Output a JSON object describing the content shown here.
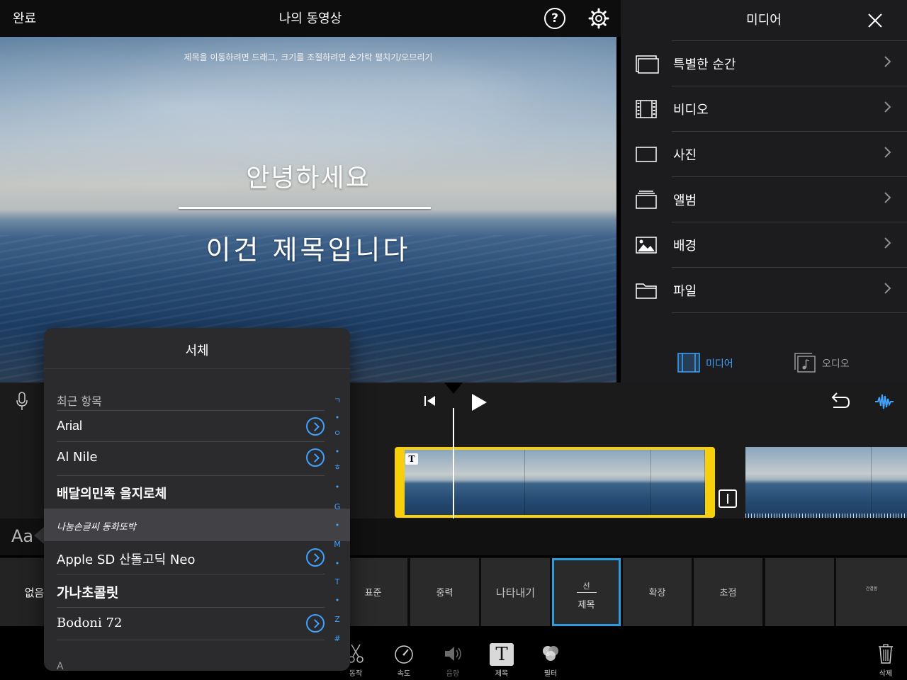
{
  "topbar": {
    "done_label": "완료",
    "title": "나의 동영상",
    "help_icon": "question-circle-icon",
    "settings_icon": "gear-icon"
  },
  "viewer": {
    "hint": "제목을 이동하려면 드래그, 크기를 조절하려면 손가락 펼치기/오므리기",
    "title_line1": "안녕하세요",
    "title_line2": "이건 제목입니다"
  },
  "media_panel": {
    "title": "미디어",
    "items": [
      {
        "label": "특별한 순간",
        "icon": "moments-icon"
      },
      {
        "label": "비디오",
        "icon": "film-icon"
      },
      {
        "label": "사진",
        "icon": "photo-frame-icon"
      },
      {
        "label": "앨범",
        "icon": "album-icon"
      },
      {
        "label": "배경",
        "icon": "landscape-icon"
      },
      {
        "label": "파일",
        "icon": "folder-icon"
      }
    ],
    "tabs": {
      "media": "미디어",
      "audio": "오디오"
    },
    "colors": {
      "accent": "#3fa2ff",
      "panel_bg": "#1c1c1e"
    }
  },
  "timeline": {
    "clip_badge": "T",
    "clip_border_color": "#f8cf0b"
  },
  "font_popover": {
    "title": "서체",
    "section": "최근 항목",
    "fonts": [
      {
        "name": "Arial",
        "info": true
      },
      {
        "name": "Al Nile",
        "info": true
      },
      {
        "name": "배달의민족 을지로체",
        "info": false
      },
      {
        "name": "나눔손글씨 동화또박",
        "info": false
      },
      {
        "name": "Apple SD 산돌고딕 Neo",
        "info": true
      },
      {
        "name": "가나초콜릿",
        "info": false
      },
      {
        "name": "Bodoni 72",
        "info": true
      }
    ],
    "bottom_letter": "A",
    "index": [
      "ㄱ",
      "•",
      "ㅇ",
      "•",
      "ㅎ",
      "•",
      "G",
      "•",
      "M",
      "•",
      "T",
      "•",
      "Z",
      "#"
    ]
  },
  "style_strip": {
    "aa_label": "Aa",
    "tiles": [
      "없음",
      "표준",
      "중력",
      "나타내기",
      "선",
      "확장",
      "초점",
      "",
      "간결함"
    ],
    "selected_top": "선",
    "selected_bottom": "제목"
  },
  "toolbar": {
    "tools": [
      {
        "label": "동작",
        "icon": "scissors-icon"
      },
      {
        "label": "속도",
        "icon": "speedometer-icon"
      },
      {
        "label": "음량",
        "icon": "speaker-icon"
      },
      {
        "label": "제목",
        "icon": "title-t-icon"
      },
      {
        "label": "필터",
        "icon": "filter-circles-icon"
      }
    ],
    "delete_label": "삭제",
    "delete_icon": "trash-icon"
  }
}
